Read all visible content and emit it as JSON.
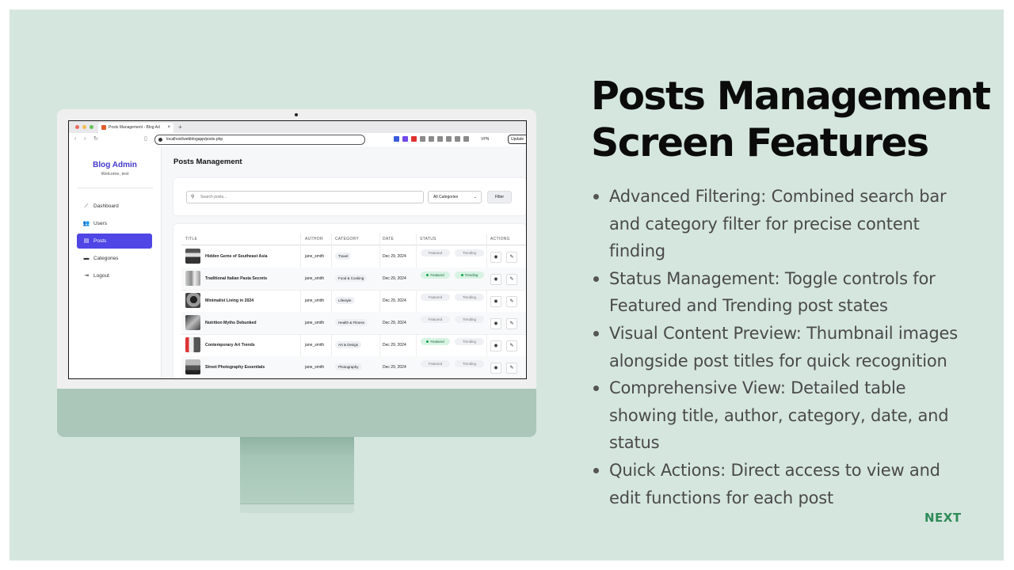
{
  "browser": {
    "tab_title": "Posts Management - Blog Ad",
    "tab_close": "×",
    "new_tab": "+",
    "url": "localhost/webblogapp/posts.php",
    "vpn_label": "VPN",
    "update_label": "Update"
  },
  "sidebar": {
    "brand": "Blog Admin",
    "welcome": "Welcome, test",
    "items": [
      {
        "label": "Dashboard",
        "icon": "chart-line-icon"
      },
      {
        "label": "Users",
        "icon": "users-icon"
      },
      {
        "label": "Posts",
        "icon": "file-icon",
        "active": true
      },
      {
        "label": "Categories",
        "icon": "folder-icon"
      },
      {
        "label": "Logout",
        "icon": "logout-icon"
      }
    ]
  },
  "main": {
    "title": "Posts Management",
    "search_placeholder": "Search posts...",
    "category_select": "All Categories",
    "filter_button": "Filter"
  },
  "table": {
    "columns": [
      "TITLE",
      "AUTHOR",
      "CATEGORY",
      "DATE",
      "STATUS",
      "ACTIONS"
    ],
    "rows": [
      {
        "title": "Hidden Gems of Southeast Asia",
        "author": "jane_smith",
        "category": "Travel",
        "date": "Dec 29, 2024",
        "featured": false,
        "trending": false
      },
      {
        "title": "Traditional Italian Pasta Secrets",
        "author": "jane_smith",
        "category": "Food & Cooking",
        "date": "Dec 29, 2024",
        "featured": true,
        "trending": true
      },
      {
        "title": "Minimalist Living in 2024",
        "author": "jane_smith",
        "category": "Lifestyle",
        "date": "Dec 29, 2024",
        "featured": false,
        "trending": false
      },
      {
        "title": "Nutrition Myths Debunked",
        "author": "jane_smith",
        "category": "Health & Fitness",
        "date": "Dec 29, 2024",
        "featured": false,
        "trending": false
      },
      {
        "title": "Contemporary Art Trends",
        "author": "jane_smith",
        "category": "Art & Design",
        "date": "Dec 29, 2024",
        "featured": true,
        "trending": false
      },
      {
        "title": "Street Photography Essentials",
        "author": "jane_smith",
        "category": "Photography",
        "date": "Dec 29, 2024",
        "featured": false,
        "trending": false
      }
    ],
    "featured_label": "Featured",
    "trending_label": "Trending"
  },
  "slide": {
    "title_line1": "Posts Management",
    "title_line2": "Screen Features",
    "bullets": [
      "Advanced Filtering: Combined search bar and category filter for precise content finding",
      "Status Management: Toggle controls for Featured and Trending post states",
      "Visual Content Preview: Thumbnail images alongside post titles for quick recognition",
      "Comprehensive View: Detailed table showing title, author, category, date, and status",
      "Quick Actions: Direct access to view and edit functions for each post"
    ],
    "next": "NEXT"
  },
  "colors": {
    "slide_bg": "#d5e6df",
    "accent": "#4f46e5",
    "brand": "#4338ca",
    "next": "#2e8b57",
    "status_on": "#16a34a"
  }
}
